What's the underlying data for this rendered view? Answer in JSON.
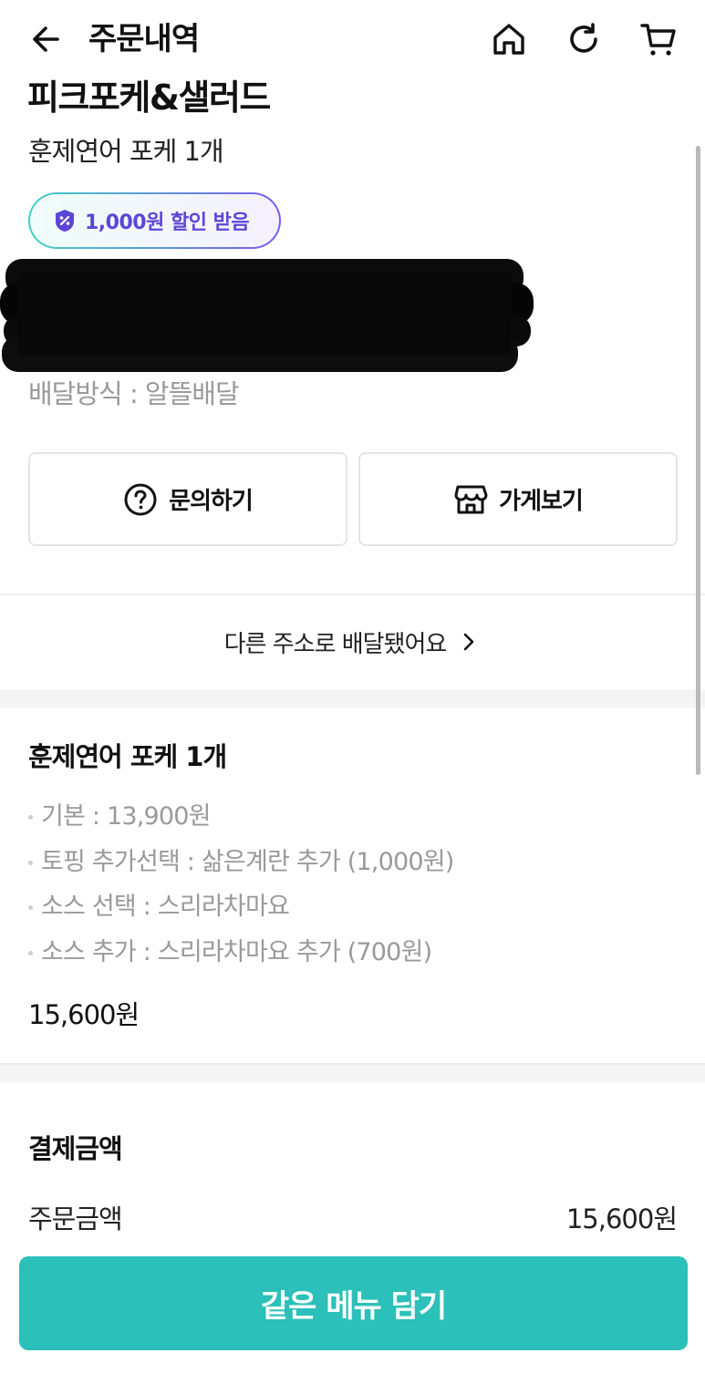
{
  "header": {
    "title": "주문내역",
    "back_icon": "arrow-left-icon",
    "home_icon": "home-icon",
    "refresh_icon": "refresh-icon",
    "cart_icon": "cart-icon"
  },
  "order": {
    "store_name": "피크포케&샐러드",
    "summary": "훈제연어 포케 1개",
    "discount_badge": "1,000원 할인 받음",
    "delivery_method": "배달방식 : 알뜰배달"
  },
  "actions": {
    "inquiry_label": "문의하기",
    "store_label": "가게보기"
  },
  "other_address": {
    "label": "다른 주소로 배달됐어요"
  },
  "item": {
    "title": "훈제연어 포케 1개",
    "options": [
      "기본 : 13,900원",
      "토핑 추가선택 : 삶은계란 추가 (1,000원)",
      "소스 선택 : 스리라차마요",
      "소스 추가 : 스리라차마요 추가 (700원)"
    ],
    "price": "15,600원"
  },
  "payment": {
    "title": "결제금액",
    "order_amount_label": "주문금액",
    "order_amount_value": "15,600원"
  },
  "cta": {
    "label": "같은 메뉴 담기"
  },
  "colors": {
    "accent": "#2bc0b9",
    "badge_text": "#5b46d6",
    "muted_text": "#9a9a9a"
  }
}
